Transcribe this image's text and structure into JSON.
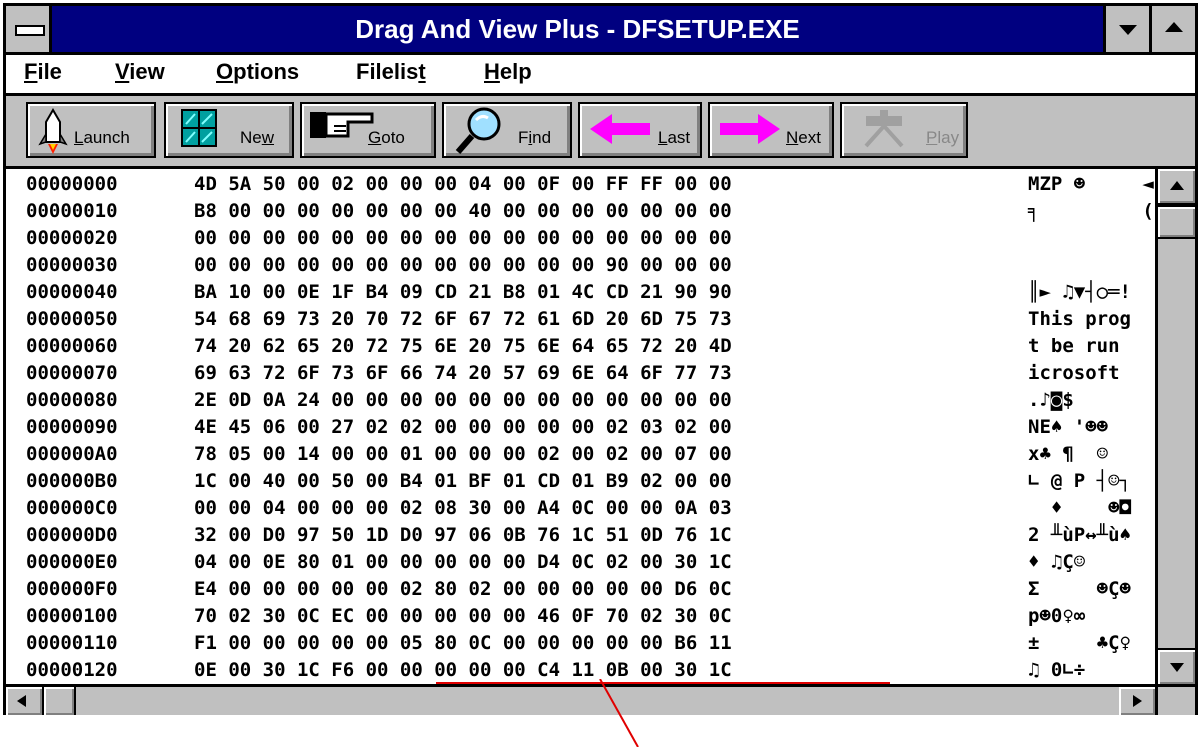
{
  "window": {
    "title": "Drag And View Plus - DFSETUP.EXE"
  },
  "menu": [
    {
      "label_u": "F",
      "label_rest": "ile"
    },
    {
      "label_u": "V",
      "label_rest": "iew"
    },
    {
      "label_u": "O",
      "label_rest": "ptions"
    },
    {
      "label_pre": "Filelis",
      "label_u": "t",
      "label_rest": ""
    },
    {
      "label_u": "H",
      "label_rest": "elp"
    }
  ],
  "toolbar": {
    "launch": {
      "u": "L",
      "rest": "aunch"
    },
    "new": {
      "pre": "Ne",
      "u": "w",
      "rest": ""
    },
    "goto": {
      "u": "G",
      "rest": "oto"
    },
    "find": {
      "pre": "F",
      "u": "i",
      "rest": "nd"
    },
    "last": {
      "u": "L",
      "rest": "ast"
    },
    "next": {
      "u": "N",
      "rest": "ext"
    },
    "play": {
      "u": "P",
      "rest": "lay",
      "disabled": true
    }
  },
  "hex": {
    "rows": [
      {
        "offset": "00000000",
        "bytes": "4D 5A 50 00 02 00 00 00 04 00 0F 00 FF FF 00 00",
        "ascii": "MZP ☻     ◄"
      },
      {
        "offset": "00000010",
        "bytes": "B8 00 00 00 00 00 00 00 40 00 00 00 00 00 00 00",
        "ascii": "╕         ("
      },
      {
        "offset": "00000020",
        "bytes": "00 00 00 00 00 00 00 00 00 00 00 00 00 00 00 00",
        "ascii": ""
      },
      {
        "offset": "00000030",
        "bytes": "00 00 00 00 00 00 00 00 00 00 00 00 90 00 00 00",
        "ascii": ""
      },
      {
        "offset": "00000040",
        "bytes": "BA 10 00 0E 1F B4 09 CD 21 B8 01 4C CD 21 90 90",
        "ascii": "║► ♫▼┤○═!"
      },
      {
        "offset": "00000050",
        "bytes": "54 68 69 73 20 70 72 6F 67 72 61 6D 20 6D 75 73",
        "ascii": "This prog"
      },
      {
        "offset": "00000060",
        "bytes": "74 20 62 65 20 72 75 6E 20 75 6E 64 65 72 20 4D",
        "ascii": "t be run"
      },
      {
        "offset": "00000070",
        "bytes": "69 63 72 6F 73 6F 66 74 20 57 69 6E 64 6F 77 73",
        "ascii": "icrosoft"
      },
      {
        "offset": "00000080",
        "bytes": "2E 0D 0A 24 00 00 00 00 00 00 00 00 00 00 00 00",
        "ascii": ".♪◙$"
      },
      {
        "offset": "00000090",
        "bytes": "4E 45 06 00 27 02 02 00 00 00 00 00 02 03 02 00",
        "ascii": "NE♠ '☻☻"
      },
      {
        "offset": "000000A0",
        "bytes": "78 05 00 14 00 00 01 00 00 00 02 00 02 00 07 00",
        "ascii": "x♣ ¶  ☺"
      },
      {
        "offset": "000000B0",
        "bytes": "1C 00 40 00 50 00 B4 01 BF 01 CD 01 B9 02 00 00",
        "ascii": "∟ @ P ┤☺┐"
      },
      {
        "offset": "000000C0",
        "bytes": "00 00 04 00 00 00 02 08 30 00 A4 0C 00 00 0A 03",
        "ascii": "  ♦    ☻◘"
      },
      {
        "offset": "000000D0",
        "bytes": "32 00 D0 97 50 1D D0 97 06 0B 76 1C 51 0D 76 1C",
        "ascii": "2 ╨ùP↔╨ù♠"
      },
      {
        "offset": "000000E0",
        "bytes": "04 00 0E 80 01 00 00 00 00 00 D4 0C 02 00 30 1C",
        "ascii": "♦ ♫Ç☺"
      },
      {
        "offset": "000000F0",
        "bytes": "E4 00 00 00 00 00 02 80 02 00 00 00 00 00 D6 0C",
        "ascii": "Σ     ☻Ç☻"
      },
      {
        "offset": "00000100",
        "bytes": "70 02 30 0C EC 00 00 00 00 00 46 0F 70 02 30 0C",
        "ascii": "p☻0♀∞"
      },
      {
        "offset": "00000110",
        "bytes": "F1 00 00 00 00 00 05 80 0C 00 00 00 00 00 B6 11",
        "ascii": "±     ♣Ç♀"
      },
      {
        "offset": "00000120",
        "bytes": "0E 00 30 1C F6 00 00 00 00 00 C4 11 0B 00 30 1C",
        "ascii": "♫ 0∟÷"
      }
    ]
  },
  "colors": {
    "titlebar": "#000080",
    "window": "#c0c0c0",
    "accent_arrow": "#ff00ff",
    "annotation_line": "#e00000"
  }
}
